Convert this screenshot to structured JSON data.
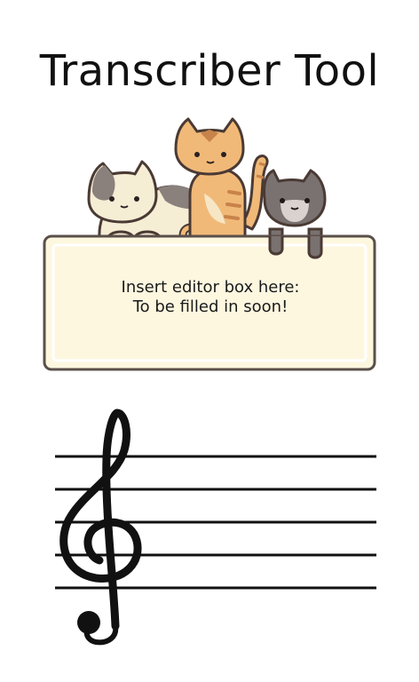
{
  "page": {
    "title": "Transcriber Tool"
  },
  "editor_placeholder": {
    "line1": "Insert editor box here:",
    "line2": "To be filled in soon!"
  },
  "colors": {
    "box_fill": "#fdf7e0",
    "box_inner": "#fffbea",
    "box_border": "#5a4f4a",
    "staff_line": "#111111",
    "cat_orange": "#f1b978",
    "cat_gray": "#7a7270",
    "cat_calico_cream": "#f6edd5"
  },
  "icons": {
    "cats": "cats-illustration",
    "clef": "treble-clef-icon"
  }
}
